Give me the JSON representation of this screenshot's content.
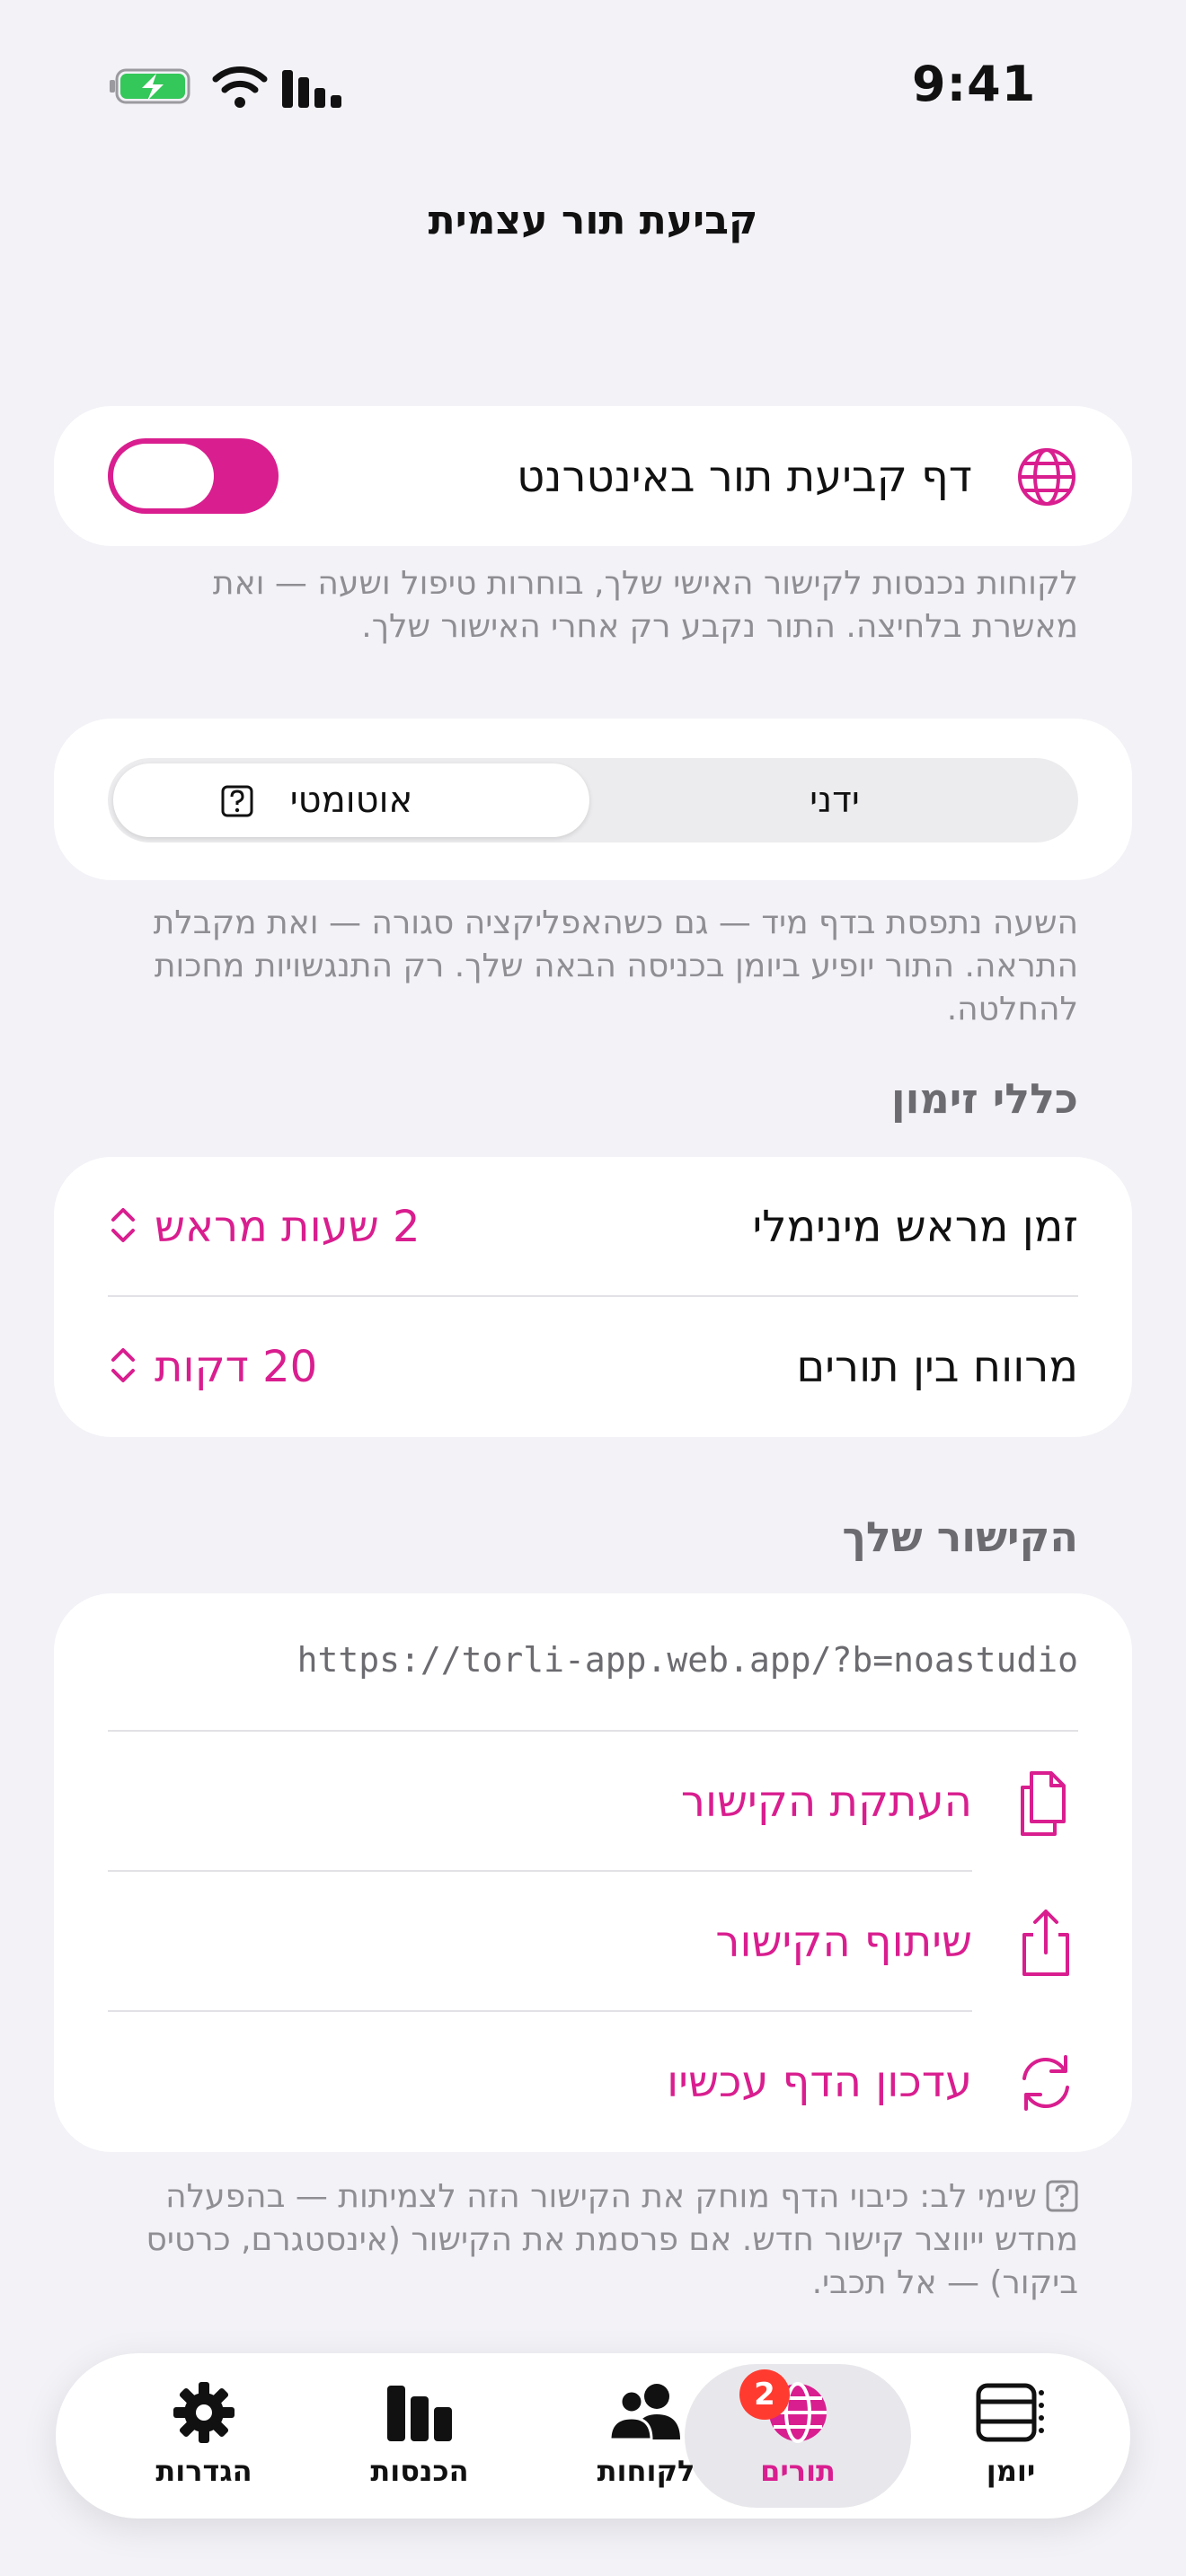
{
  "status_bar": {
    "time": "9:41"
  },
  "nav": {
    "title": "קביעת תור עצמית"
  },
  "online_booking": {
    "icon": "globe-icon",
    "label": "דף קביעת תור באינטרנט",
    "enabled": true,
    "footnote": "לקוחות נכנסות לקישור האישי שלך, בוחרות טיפול ושעה — ואת מאשרת בלחיצה. התור נקבע רק אחרי האישור שלך."
  },
  "mode": {
    "options": [
      "ידני",
      "אוטומטי"
    ],
    "selected": "אוטומטי",
    "footnote": "השעה נתפסת בדף מיד — גם כשהאפליקציה סגורה — ואת מקבלת התראה. התור יופיע ביומן בכניסה הבאה שלך. רק התנגשויות מחכות להחלטה."
  },
  "rules": {
    "header": "כללי זימון",
    "min_advance": {
      "label": "זמן מראש מינימלי",
      "value": "2 שעות מראש"
    },
    "gap": {
      "label": "מרווח בין תורים",
      "value": "20 דקות"
    }
  },
  "link": {
    "header": "הקישור שלך",
    "url": "https://torli-app.web.app/?b=noastudio",
    "copy_label": "העתקת הקישור",
    "share_label": "שיתוף הקישור",
    "refresh_label": "עדכון הדף עכשיו",
    "footnote": "שימי לב: כיבוי הדף מוחק את הקישור הזה לצמיתות — בהפעלה מחדש ייווצר קישור חדש. אם פרסמת את הקישור (אינסטגרם, כרטיס ביקור) — אל תכבי."
  },
  "tabs": {
    "settings": "הגדרות",
    "income": "הכנסות",
    "clients": "לקוחות",
    "appointments": "תורים",
    "appointments_badge": "2",
    "calendar": "יומן",
    "selected": "תורים"
  },
  "colors": {
    "accent": "#d91e8f",
    "background": "#f2f2f7",
    "badge": "#ff3b30"
  }
}
